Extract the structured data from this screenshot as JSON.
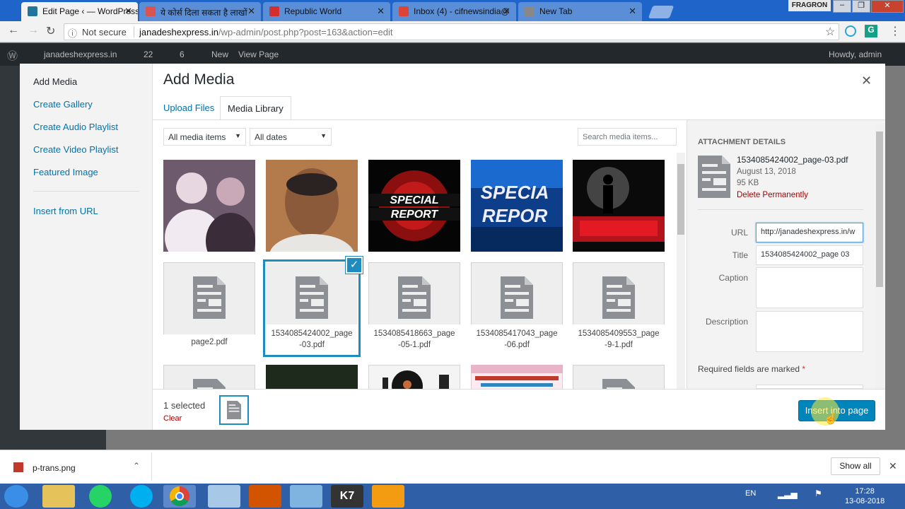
{
  "browser": {
    "tabs": [
      {
        "title": "Edit Page ‹ — WordPress",
        "color": "#21759b"
      },
      {
        "title": "ये कोर्स दिला सकता है लाखों",
        "color": "#d9534f"
      },
      {
        "title": "Republic World",
        "color": "#d32f2f"
      },
      {
        "title": "Inbox (4) - cifnewsindia@",
        "color": "#db4437"
      },
      {
        "title": "New Tab",
        "color": "#888888"
      }
    ],
    "profile": "FRAGRON",
    "security": "Not secure",
    "url_domain": "janadeshexpress.in",
    "url_path": "/wp-admin/post.php?post=163&action=edit"
  },
  "adminbar": {
    "site": "janadeshexpress.in",
    "updates": "22",
    "comments": "6",
    "new": "New",
    "view": "View Page",
    "howdy": "Howdy, admin"
  },
  "modal": {
    "menu": [
      "Add Media",
      "Create Gallery",
      "Create Audio Playlist",
      "Create Video Playlist",
      "Featured Image",
      "Insert from URL"
    ],
    "title": "Add Media",
    "tabs": [
      "Upload Files",
      "Media Library"
    ],
    "filter_type": "All media items",
    "filter_date": "All dates",
    "search_placeholder": "Search media items...",
    "items": [
      {
        "kind": "photo",
        "label": "photo-nehru"
      },
      {
        "kind": "photo",
        "label": "photo-portrait"
      },
      {
        "kind": "photo",
        "label": "special-report-red"
      },
      {
        "kind": "photo",
        "label": "special-report-blue"
      },
      {
        "kind": "photo",
        "label": "operation-poster"
      },
      {
        "kind": "doc",
        "name": "page2.pdf"
      },
      {
        "kind": "doc",
        "name": "1534085424002_page-03.pdf"
      },
      {
        "kind": "doc",
        "name": "1534085418663_page-05-1.pdf"
      },
      {
        "kind": "doc",
        "name": "1534085417043_page-06.pdf"
      },
      {
        "kind": "doc",
        "name": "1534085409553_page-9-1.pdf"
      }
    ],
    "details": {
      "heading": "ATTACHMENT DETAILS",
      "filename": "1534085424002_page-03.pdf",
      "date": "August 13, 2018",
      "size": "95 KB",
      "delete": "Delete Permanently",
      "url_label": "URL",
      "url_value": "http://janadeshexpress.in/w",
      "title_label": "Title",
      "title_value": "1534085424002_page 03",
      "caption_label": "Caption",
      "description_label": "Description",
      "required": "Required fields are marked"
    },
    "toolbar": {
      "selected": "1 selected",
      "clear": "Clear",
      "insert": "Insert into page"
    }
  },
  "downloads": {
    "file": "p-trans.png",
    "show_all": "Show all"
  },
  "taskbar": {
    "lang": "EN",
    "time": "17:28",
    "date": "13-08-2018"
  }
}
